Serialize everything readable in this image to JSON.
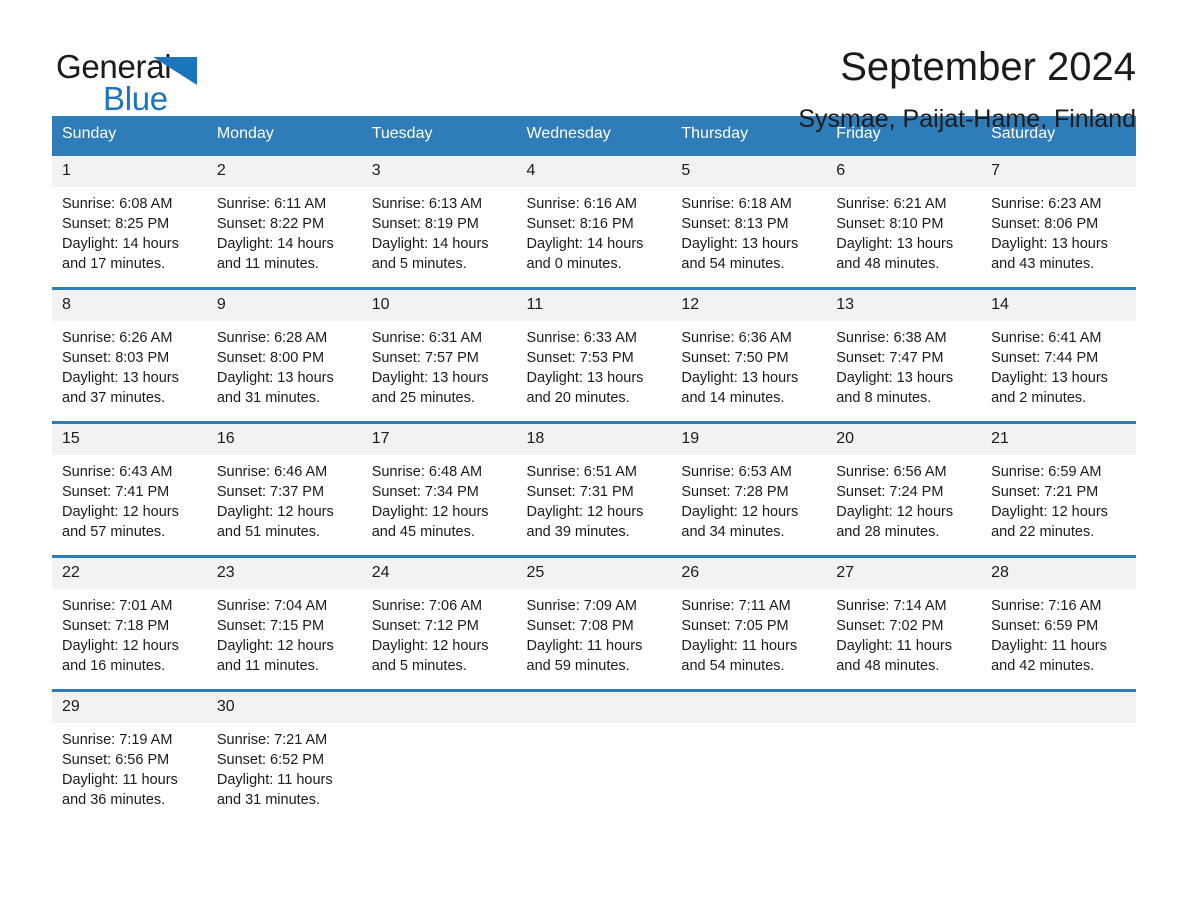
{
  "brand": {
    "name_part1": "General",
    "name_part2": "Blue",
    "logo_icon": "triangle-logo-icon",
    "accent_color": "#1b75bb"
  },
  "header": {
    "title": "September 2024",
    "subtitle": "Sysmae, Paijat-Hame, Finland"
  },
  "calendar": {
    "header_bg": "#2e7cb8",
    "daynum_bg": "#f2f2f2",
    "weekdays": [
      "Sunday",
      "Monday",
      "Tuesday",
      "Wednesday",
      "Thursday",
      "Friday",
      "Saturday"
    ],
    "weeks": [
      [
        {
          "day": "1",
          "sunrise": "Sunrise: 6:08 AM",
          "sunset": "Sunset: 8:25 PM",
          "daylight1": "Daylight: 14 hours",
          "daylight2": "and 17 minutes."
        },
        {
          "day": "2",
          "sunrise": "Sunrise: 6:11 AM",
          "sunset": "Sunset: 8:22 PM",
          "daylight1": "Daylight: 14 hours",
          "daylight2": "and 11 minutes."
        },
        {
          "day": "3",
          "sunrise": "Sunrise: 6:13 AM",
          "sunset": "Sunset: 8:19 PM",
          "daylight1": "Daylight: 14 hours",
          "daylight2": "and 5 minutes."
        },
        {
          "day": "4",
          "sunrise": "Sunrise: 6:16 AM",
          "sunset": "Sunset: 8:16 PM",
          "daylight1": "Daylight: 14 hours",
          "daylight2": "and 0 minutes."
        },
        {
          "day": "5",
          "sunrise": "Sunrise: 6:18 AM",
          "sunset": "Sunset: 8:13 PM",
          "daylight1": "Daylight: 13 hours",
          "daylight2": "and 54 minutes."
        },
        {
          "day": "6",
          "sunrise": "Sunrise: 6:21 AM",
          "sunset": "Sunset: 8:10 PM",
          "daylight1": "Daylight: 13 hours",
          "daylight2": "and 48 minutes."
        },
        {
          "day": "7",
          "sunrise": "Sunrise: 6:23 AM",
          "sunset": "Sunset: 8:06 PM",
          "daylight1": "Daylight: 13 hours",
          "daylight2": "and 43 minutes."
        }
      ],
      [
        {
          "day": "8",
          "sunrise": "Sunrise: 6:26 AM",
          "sunset": "Sunset: 8:03 PM",
          "daylight1": "Daylight: 13 hours",
          "daylight2": "and 37 minutes."
        },
        {
          "day": "9",
          "sunrise": "Sunrise: 6:28 AM",
          "sunset": "Sunset: 8:00 PM",
          "daylight1": "Daylight: 13 hours",
          "daylight2": "and 31 minutes."
        },
        {
          "day": "10",
          "sunrise": "Sunrise: 6:31 AM",
          "sunset": "Sunset: 7:57 PM",
          "daylight1": "Daylight: 13 hours",
          "daylight2": "and 25 minutes."
        },
        {
          "day": "11",
          "sunrise": "Sunrise: 6:33 AM",
          "sunset": "Sunset: 7:53 PM",
          "daylight1": "Daylight: 13 hours",
          "daylight2": "and 20 minutes."
        },
        {
          "day": "12",
          "sunrise": "Sunrise: 6:36 AM",
          "sunset": "Sunset: 7:50 PM",
          "daylight1": "Daylight: 13 hours",
          "daylight2": "and 14 minutes."
        },
        {
          "day": "13",
          "sunrise": "Sunrise: 6:38 AM",
          "sunset": "Sunset: 7:47 PM",
          "daylight1": "Daylight: 13 hours",
          "daylight2": "and 8 minutes."
        },
        {
          "day": "14",
          "sunrise": "Sunrise: 6:41 AM",
          "sunset": "Sunset: 7:44 PM",
          "daylight1": "Daylight: 13 hours",
          "daylight2": "and 2 minutes."
        }
      ],
      [
        {
          "day": "15",
          "sunrise": "Sunrise: 6:43 AM",
          "sunset": "Sunset: 7:41 PM",
          "daylight1": "Daylight: 12 hours",
          "daylight2": "and 57 minutes."
        },
        {
          "day": "16",
          "sunrise": "Sunrise: 6:46 AM",
          "sunset": "Sunset: 7:37 PM",
          "daylight1": "Daylight: 12 hours",
          "daylight2": "and 51 minutes."
        },
        {
          "day": "17",
          "sunrise": "Sunrise: 6:48 AM",
          "sunset": "Sunset: 7:34 PM",
          "daylight1": "Daylight: 12 hours",
          "daylight2": "and 45 minutes."
        },
        {
          "day": "18",
          "sunrise": "Sunrise: 6:51 AM",
          "sunset": "Sunset: 7:31 PM",
          "daylight1": "Daylight: 12 hours",
          "daylight2": "and 39 minutes."
        },
        {
          "day": "19",
          "sunrise": "Sunrise: 6:53 AM",
          "sunset": "Sunset: 7:28 PM",
          "daylight1": "Daylight: 12 hours",
          "daylight2": "and 34 minutes."
        },
        {
          "day": "20",
          "sunrise": "Sunrise: 6:56 AM",
          "sunset": "Sunset: 7:24 PM",
          "daylight1": "Daylight: 12 hours",
          "daylight2": "and 28 minutes."
        },
        {
          "day": "21",
          "sunrise": "Sunrise: 6:59 AM",
          "sunset": "Sunset: 7:21 PM",
          "daylight1": "Daylight: 12 hours",
          "daylight2": "and 22 minutes."
        }
      ],
      [
        {
          "day": "22",
          "sunrise": "Sunrise: 7:01 AM",
          "sunset": "Sunset: 7:18 PM",
          "daylight1": "Daylight: 12 hours",
          "daylight2": "and 16 minutes."
        },
        {
          "day": "23",
          "sunrise": "Sunrise: 7:04 AM",
          "sunset": "Sunset: 7:15 PM",
          "daylight1": "Daylight: 12 hours",
          "daylight2": "and 11 minutes."
        },
        {
          "day": "24",
          "sunrise": "Sunrise: 7:06 AM",
          "sunset": "Sunset: 7:12 PM",
          "daylight1": "Daylight: 12 hours",
          "daylight2": "and 5 minutes."
        },
        {
          "day": "25",
          "sunrise": "Sunrise: 7:09 AM",
          "sunset": "Sunset: 7:08 PM",
          "daylight1": "Daylight: 11 hours",
          "daylight2": "and 59 minutes."
        },
        {
          "day": "26",
          "sunrise": "Sunrise: 7:11 AM",
          "sunset": "Sunset: 7:05 PM",
          "daylight1": "Daylight: 11 hours",
          "daylight2": "and 54 minutes."
        },
        {
          "day": "27",
          "sunrise": "Sunrise: 7:14 AM",
          "sunset": "Sunset: 7:02 PM",
          "daylight1": "Daylight: 11 hours",
          "daylight2": "and 48 minutes."
        },
        {
          "day": "28",
          "sunrise": "Sunrise: 7:16 AM",
          "sunset": "Sunset: 6:59 PM",
          "daylight1": "Daylight: 11 hours",
          "daylight2": "and 42 minutes."
        }
      ],
      [
        {
          "day": "29",
          "sunrise": "Sunrise: 7:19 AM",
          "sunset": "Sunset: 6:56 PM",
          "daylight1": "Daylight: 11 hours",
          "daylight2": "and 36 minutes."
        },
        {
          "day": "30",
          "sunrise": "Sunrise: 7:21 AM",
          "sunset": "Sunset: 6:52 PM",
          "daylight1": "Daylight: 11 hours",
          "daylight2": "and 31 minutes."
        },
        {
          "day": "",
          "sunrise": "",
          "sunset": "",
          "daylight1": "",
          "daylight2": ""
        },
        {
          "day": "",
          "sunrise": "",
          "sunset": "",
          "daylight1": "",
          "daylight2": ""
        },
        {
          "day": "",
          "sunrise": "",
          "sunset": "",
          "daylight1": "",
          "daylight2": ""
        },
        {
          "day": "",
          "sunrise": "",
          "sunset": "",
          "daylight1": "",
          "daylight2": ""
        },
        {
          "day": "",
          "sunrise": "",
          "sunset": "",
          "daylight1": "",
          "daylight2": ""
        }
      ]
    ]
  }
}
